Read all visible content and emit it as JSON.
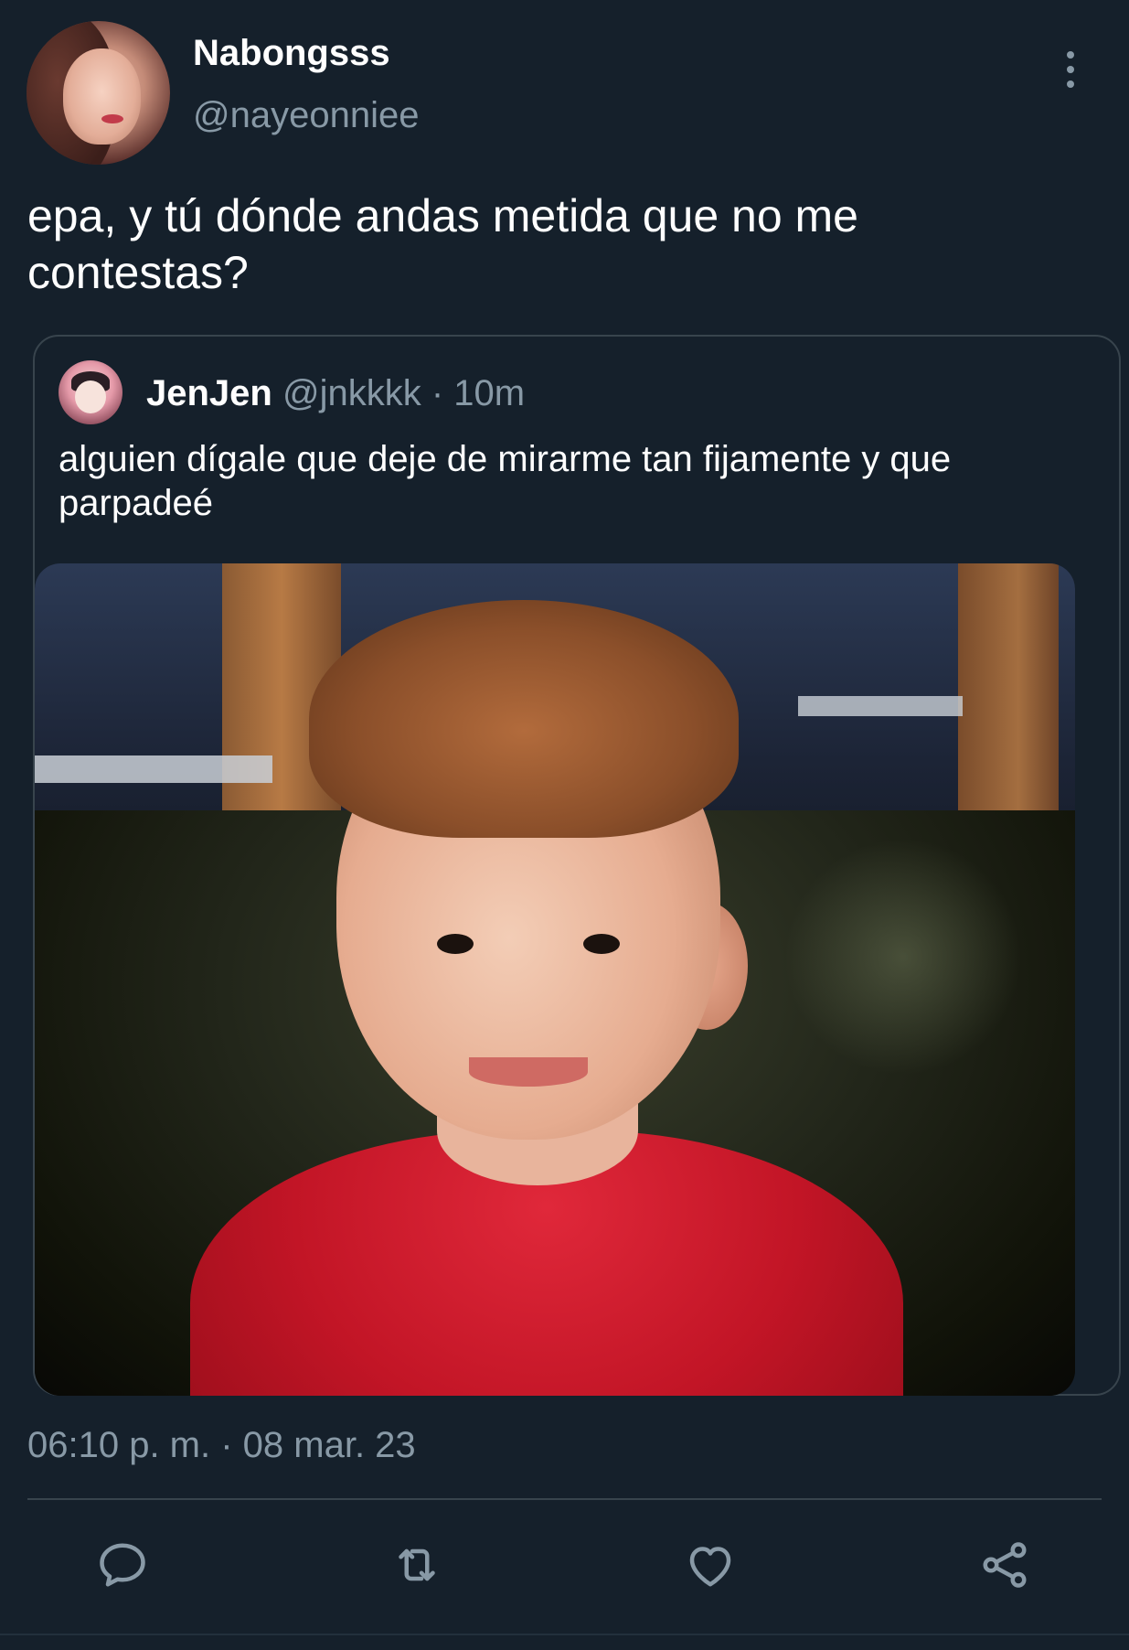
{
  "author": {
    "display_name": "Nabongsss",
    "handle": "@nayeonniee"
  },
  "tweet": {
    "text": "epa, y tú dónde andas metida que no me contestas?",
    "timestamp": "06:10 p. m. · 08 mar. 23"
  },
  "quoted": {
    "display_name": "JenJen",
    "handle": "@jnkkkk",
    "meta": " · 10m",
    "text": "alguien dígale que deje de mirarme tan fijamente y que parpadeé"
  },
  "icons": {
    "more": "more-vertical-icon",
    "reply": "reply-icon",
    "retweet": "retweet-icon",
    "like": "heart-icon",
    "share": "share-icon"
  },
  "colors": {
    "background": "#15202b",
    "secondary_text": "#8899a6",
    "border": "#38444d"
  }
}
